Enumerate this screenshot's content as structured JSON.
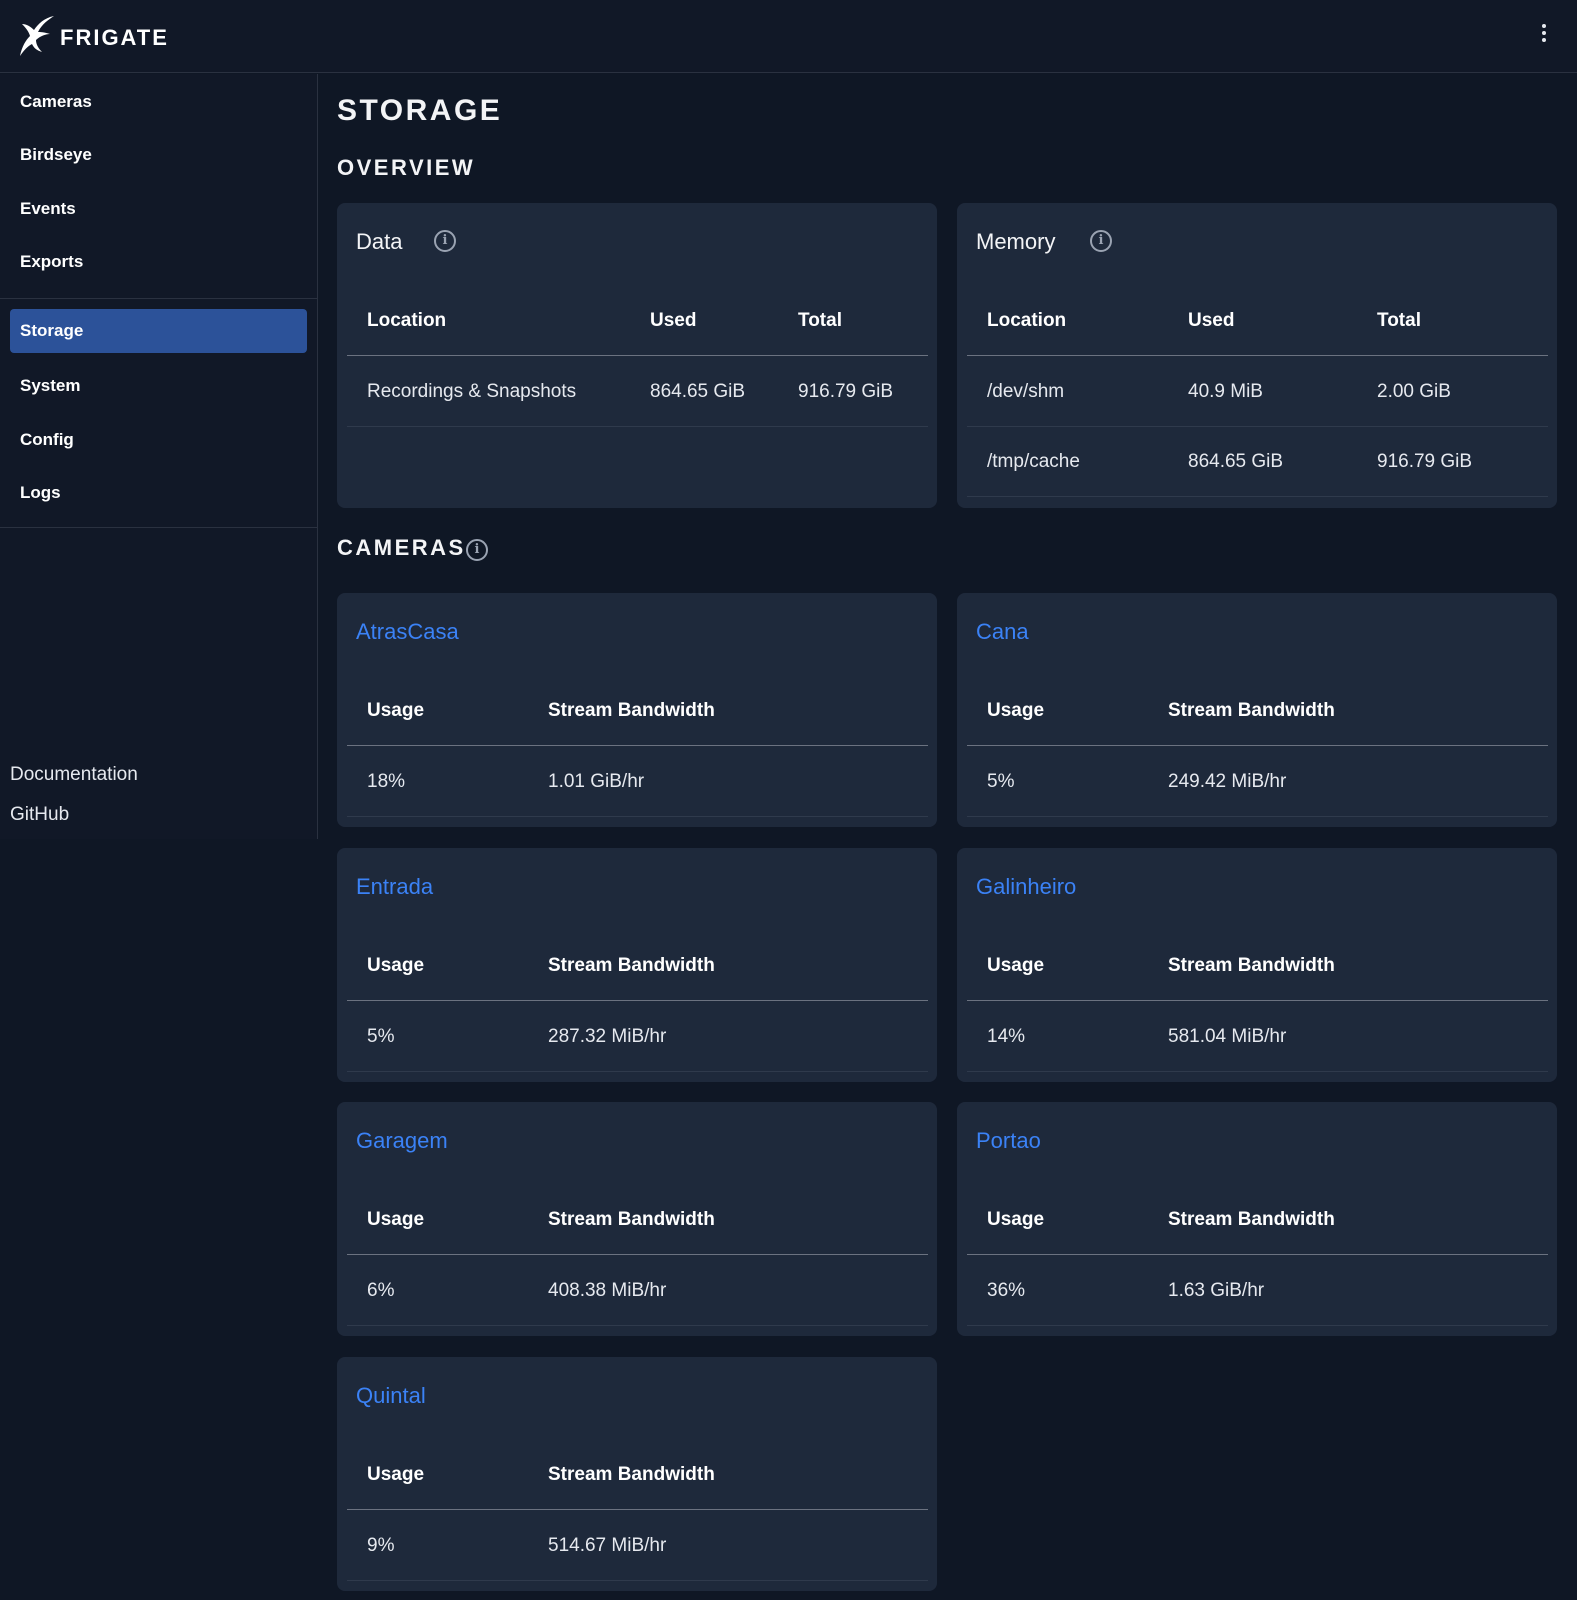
{
  "app": {
    "brand": "FRIGATE"
  },
  "sidebar": {
    "items": [
      {
        "label": "Cameras"
      },
      {
        "label": "Birdseye"
      },
      {
        "label": "Events"
      },
      {
        "label": "Exports"
      },
      {
        "label": "Storage",
        "active": true
      },
      {
        "label": "System"
      },
      {
        "label": "Config"
      },
      {
        "label": "Logs"
      }
    ],
    "links": [
      {
        "label": "Documentation"
      },
      {
        "label": "GitHub"
      }
    ]
  },
  "page": {
    "title": "STORAGE",
    "overview_heading": "OVERVIEW",
    "cameras_heading": "CAMERAS"
  },
  "data_card": {
    "title": "Data",
    "headers": [
      "Location",
      "Used",
      "Total"
    ],
    "rows": [
      [
        "Recordings & Snapshots",
        "864.65 GiB",
        "916.79 GiB"
      ]
    ]
  },
  "memory_card": {
    "title": "Memory",
    "headers": [
      "Location",
      "Used",
      "Total"
    ],
    "rows": [
      [
        "/dev/shm",
        "40.9 MiB",
        "2.00 GiB"
      ],
      [
        "/tmp/cache",
        "864.65 GiB",
        "916.79 GiB"
      ]
    ]
  },
  "camera_headers": [
    "Usage",
    "Stream Bandwidth"
  ],
  "cameras": [
    {
      "name": "AtrasCasa",
      "usage": "18%",
      "bandwidth": "1.01 GiB/hr"
    },
    {
      "name": "Cana",
      "usage": "5%",
      "bandwidth": "249.42 MiB/hr"
    },
    {
      "name": "Entrada",
      "usage": "5%",
      "bandwidth": "287.32 MiB/hr"
    },
    {
      "name": "Galinheiro",
      "usage": "14%",
      "bandwidth": "581.04 MiB/hr"
    },
    {
      "name": "Garagem",
      "usage": "6%",
      "bandwidth": "408.38 MiB/hr"
    },
    {
      "name": "Portao",
      "usage": "36%",
      "bandwidth": "1.63 GiB/hr"
    },
    {
      "name": "Quintal",
      "usage": "9%",
      "bandwidth": "514.67 MiB/hr"
    }
  ],
  "colors": {
    "background": "#0f1725",
    "surface": "#1e293b",
    "accent": "#3b82f6",
    "active_nav": "#2c5299"
  }
}
